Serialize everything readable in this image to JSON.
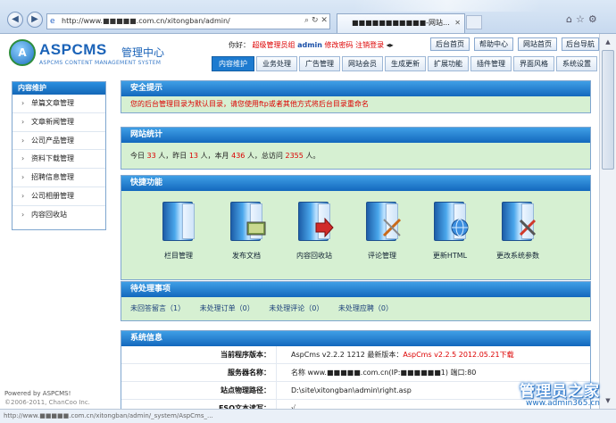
{
  "browser": {
    "address": "http://www.■■■■■.com.cn/xitongban/admin/",
    "tab_title": "■■■■■■■■■■■-网站...",
    "window_title_blurred": "",
    "status_url": "http://www.■■■■■.com.cn/xitongban/admin/_system/AspCms_..."
  },
  "header": {
    "brand": "ASPCMS",
    "brand_cn": "管理中心",
    "brand_sub": "ASPCMS CONTENT MANAGEMENT SYSTEM",
    "greeting": "你好：",
    "role": "超级管理员组",
    "username": "admin",
    "change_password": "修改密码",
    "logout": "注销登录",
    "top_buttons": [
      "后台首页",
      "帮助中心",
      "网站首页",
      "后台导航"
    ],
    "nav_tabs": [
      "内容维护",
      "业务处理",
      "广告管理",
      "网站会员",
      "生成更新",
      "扩展功能",
      "插件管理",
      "界面风格",
      "系统设置"
    ],
    "active_tab": 0
  },
  "sidebar": {
    "title": "内容维护",
    "items": [
      "单篇文章管理",
      "文章新闻管理",
      "公司产品管理",
      "资料下载管理",
      "招聘信息管理",
      "公司相册管理",
      "内容回收站"
    ],
    "powered": "Powered by ASPCMS!",
    "copyright": "©2006-2011, ChanCoo Inc."
  },
  "security": {
    "title": "安全提示",
    "message": "您的后台管理目录为默认目录，请您使用ftp或者其他方式将后台目录重命名"
  },
  "stats": {
    "title": "网站统计",
    "today_label": "今日",
    "today": "33",
    "yesterday_label": "人，昨日",
    "yesterday": "13",
    "month_label": "人，本月",
    "month": "436",
    "total_label": "人，总访问",
    "total": "2355",
    "end": "人。"
  },
  "quick": {
    "title": "快捷功能",
    "items": [
      {
        "label": "栏目管理",
        "icon": "folder-book-icon"
      },
      {
        "label": "发布文档",
        "icon": "publish-doc-icon"
      },
      {
        "label": "内容回收站",
        "icon": "recycle-bin-icon"
      },
      {
        "label": "评论管理",
        "icon": "comment-edit-icon"
      },
      {
        "label": "更新HTML",
        "icon": "update-html-icon"
      },
      {
        "label": "更改系统参数",
        "icon": "system-tools-icon"
      }
    ]
  },
  "todo": {
    "title": "待处理事项",
    "items": [
      "未回答留言（1）",
      "未处理订单（0）",
      "未处理评论（0）",
      "未处理应聘（0）"
    ]
  },
  "system": {
    "title": "系统信息",
    "rows": [
      {
        "key": "当前程序版本：",
        "value": "AspCms v2.2.2 1212 最新版本：",
        "extra": "AspCms v2.2.5 2012.05.21下载"
      },
      {
        "key": "服务器名称：",
        "value": "名称 www.■■■■■.com.cn(IP:■■■■■■1) 端口:80",
        "extra": ""
      },
      {
        "key": "站点物理路径：",
        "value": "D:\\site\\xitongban\\admin\\right.asp",
        "extra": ""
      },
      {
        "key": "FSO文本读写：",
        "value": "√",
        "extra": ""
      }
    ]
  },
  "watermark": {
    "main": "管理员之家",
    "url": "www.admin365.cn"
  }
}
